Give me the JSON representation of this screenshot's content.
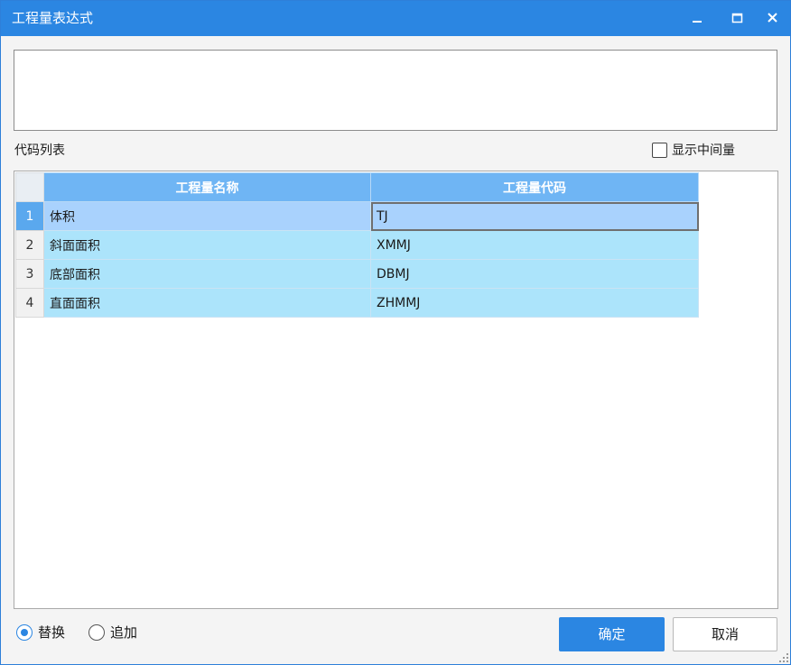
{
  "window": {
    "title": "工程量表达式",
    "controls": [
      "minimize-icon",
      "maximize-icon",
      "close-icon"
    ]
  },
  "expression": {
    "value": "",
    "placeholder": ""
  },
  "code_list": {
    "label": "代码列表",
    "show_intermediate_label": "显示中间量",
    "show_intermediate_checked": false,
    "columns": [
      "工程量名称",
      "工程量代码"
    ],
    "rows": [
      {
        "num": "1",
        "name": "体积",
        "code": "TJ",
        "selected": true
      },
      {
        "num": "2",
        "name": "斜面面积",
        "code": "XMMJ",
        "selected": false
      },
      {
        "num": "3",
        "name": "底部面积",
        "code": "DBMJ",
        "selected": false
      },
      {
        "num": "4",
        "name": "直面面积",
        "code": "ZHMMJ",
        "selected": false
      }
    ]
  },
  "mode": {
    "options": [
      {
        "label": "替换",
        "checked": true
      },
      {
        "label": "追加",
        "checked": false
      }
    ]
  },
  "buttons": {
    "ok": "确定",
    "cancel": "取消"
  },
  "colors": {
    "accent": "#2b86e2",
    "header": "#6fb5f4",
    "row": "#ace4fb",
    "selected_row": "#a9d2fd"
  }
}
